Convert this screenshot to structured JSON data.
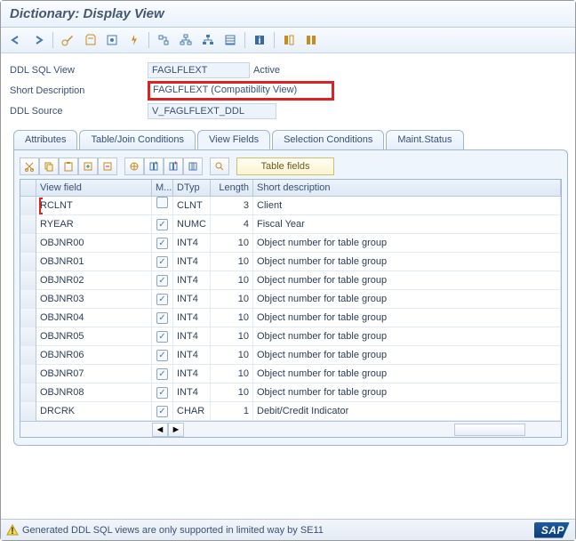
{
  "title": "Dictionary: Display View",
  "form": {
    "l_view": "DDL SQL View",
    "v_view": "FAGLFLEXT",
    "status": "Active",
    "l_desc": "Short Description",
    "v_desc": "FAGLFLEXT (Compatibility View)",
    "l_src": "DDL Source",
    "v_src": "V_FAGLFLEXT_DDL"
  },
  "tabs": {
    "attr": "Attributes",
    "join": "Table/Join Conditions",
    "vf": "View Fields",
    "sel": "Selection Conditions",
    "maint": "Maint.Status"
  },
  "tf_label": "Table fields",
  "grid": {
    "h_vf": "View field",
    "h_m": "M...",
    "h_dt": "DTyp",
    "h_len": "Length",
    "h_sd": "Short description",
    "rows": [
      {
        "vf": "RCLNT",
        "m": false,
        "dt": "CLNT",
        "len": "3",
        "sd": "Client"
      },
      {
        "vf": "RYEAR",
        "m": true,
        "dt": "NUMC",
        "len": "4",
        "sd": "Fiscal Year"
      },
      {
        "vf": "OBJNR00",
        "m": true,
        "dt": "INT4",
        "len": "10",
        "sd": "Object number for table group"
      },
      {
        "vf": "OBJNR01",
        "m": true,
        "dt": "INT4",
        "len": "10",
        "sd": "Object number for table group"
      },
      {
        "vf": "OBJNR02",
        "m": true,
        "dt": "INT4",
        "len": "10",
        "sd": "Object number for table group"
      },
      {
        "vf": "OBJNR03",
        "m": true,
        "dt": "INT4",
        "len": "10",
        "sd": "Object number for table group"
      },
      {
        "vf": "OBJNR04",
        "m": true,
        "dt": "INT4",
        "len": "10",
        "sd": "Object number for table group"
      },
      {
        "vf": "OBJNR05",
        "m": true,
        "dt": "INT4",
        "len": "10",
        "sd": "Object number for table group"
      },
      {
        "vf": "OBJNR06",
        "m": true,
        "dt": "INT4",
        "len": "10",
        "sd": "Object number for table group"
      },
      {
        "vf": "OBJNR07",
        "m": true,
        "dt": "INT4",
        "len": "10",
        "sd": "Object number for table group"
      },
      {
        "vf": "OBJNR08",
        "m": true,
        "dt": "INT4",
        "len": "10",
        "sd": "Object number for table group"
      },
      {
        "vf": "DRCRK",
        "m": true,
        "dt": "CHAR",
        "len": "1",
        "sd": "Debit/Credit Indicator"
      }
    ]
  },
  "status_msg": "Generated DDL SQL views are only supported in limited way by SE11",
  "sap": "SAP"
}
